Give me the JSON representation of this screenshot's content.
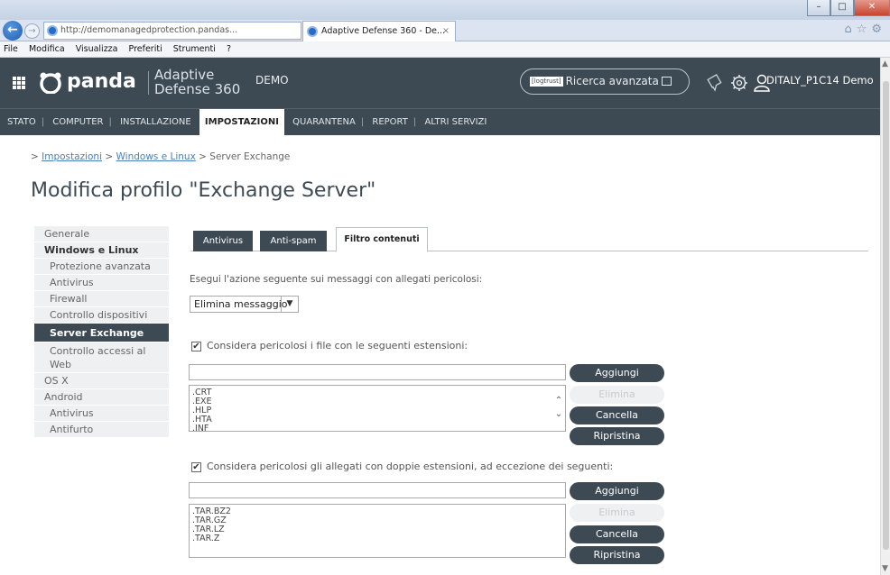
{
  "browser": {
    "url": "http://demomanagedprotection.pandas...",
    "url_controls": "⌕ ▾ ↻",
    "tab_title": "Adaptive Defense 360 - De...",
    "tab_close": "×",
    "window_buttons": [
      "–",
      "□",
      "✕"
    ],
    "right_icons": "⌂☆⚙",
    "menu": [
      "File",
      "Modifica",
      "Visualizza",
      "Preferiti",
      "Strumenti",
      "?"
    ]
  },
  "header": {
    "brand": "panda",
    "product_line1": "Adaptive",
    "product_line2": "Defense 360",
    "demo": "DEMO",
    "search_tag": "[logtrust]",
    "search_label": "Ricerca avanzata",
    "user": "DITALY_P1C14 Demo"
  },
  "nav": {
    "items": [
      "STATO",
      "COMPUTER",
      "INSTALLAZIONE",
      "IMPOSTAZIONI",
      "QUARANTENA",
      "REPORT",
      "ALTRI SERVIZI"
    ],
    "active": "IMPOSTAZIONI"
  },
  "breadcrumb": {
    "prefix": "> ",
    "link1": "Impostazioni",
    "sep1": " > ",
    "link2": "Windows e Linux",
    "sep2": " > ",
    "current": "Server Exchange"
  },
  "page_title": "Modifica profilo \"Exchange Server\"",
  "sidebar": {
    "items": [
      {
        "label": "Generale"
      },
      {
        "label": "Windows e Linux"
      },
      {
        "label": "Protezione avanzata"
      },
      {
        "label": "Antivirus"
      },
      {
        "label": "Firewall"
      },
      {
        "label": "Controllo dispositivi"
      },
      {
        "label": "Server Exchange"
      },
      {
        "label": "Controllo accessi al Web"
      },
      {
        "label": "OS X"
      },
      {
        "label": "Android"
      },
      {
        "label": "Antivirus"
      },
      {
        "label": "Antifurto"
      }
    ]
  },
  "tabs": [
    "Antivirus",
    "Anti-spam",
    "Filtro contenuti"
  ],
  "content": {
    "action_label": "Esegui l'azione seguente sui messaggi con allegati pericolosi:",
    "action_value": "Elimina messaggio",
    "ext_check_label": "Considera pericolosi i file con le seguenti estensioni:",
    "ext_checked": "✔",
    "ext_list": [
      ".CRT",
      ".EXE",
      ".HLP",
      ".HTA",
      ".INF"
    ],
    "double_check_label": "Considera pericolosi gli allegati con doppie estensioni, ad eccezione dei seguenti:",
    "double_checked": "✔",
    "double_list": [
      ".TAR.BZ2",
      ".TAR.GZ",
      ".TAR.LZ",
      ".TAR.Z"
    ]
  },
  "buttons": {
    "add": "Aggiungi",
    "remove": "Elimina",
    "clear": "Cancella",
    "restore": "Ripristina"
  },
  "colors": {
    "header_bg": "#3d4a53",
    "link": "#4a7fb5"
  }
}
